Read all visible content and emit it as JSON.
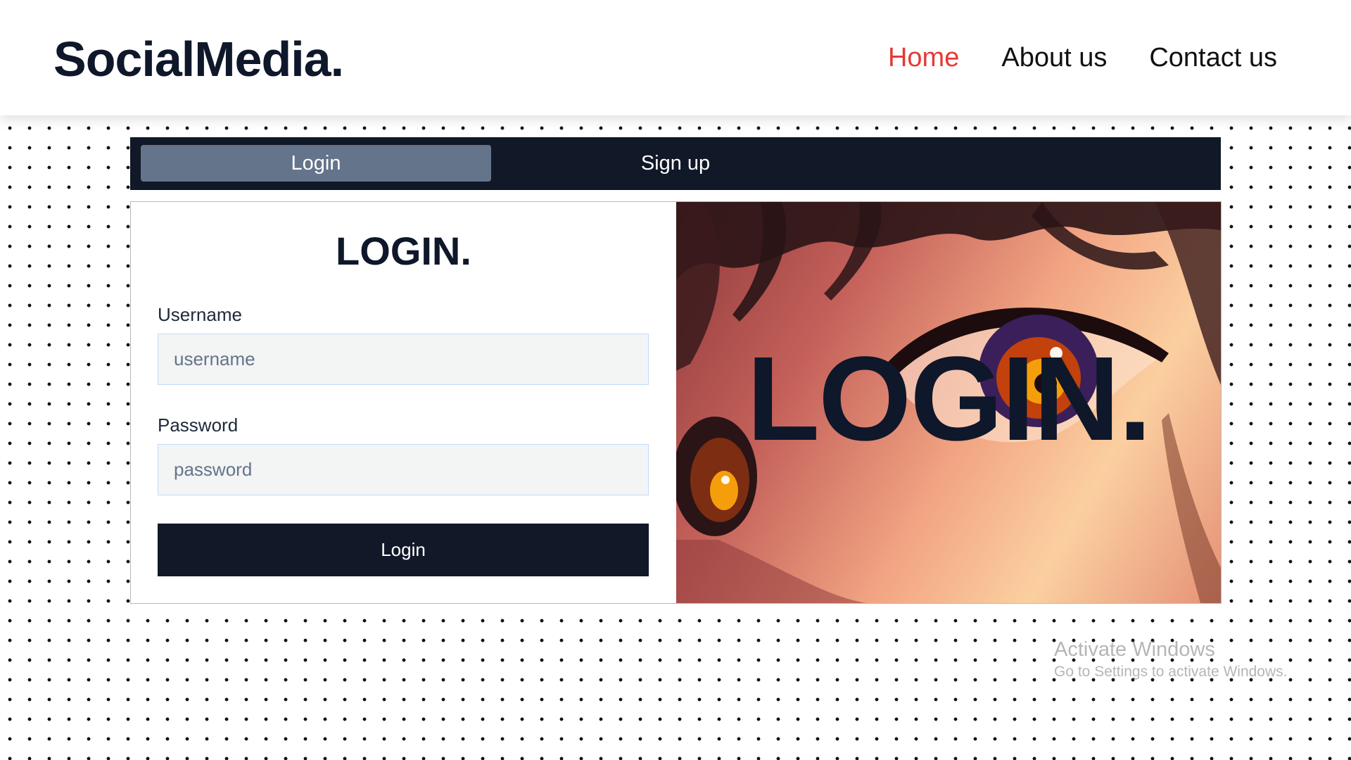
{
  "header": {
    "logo": "SocialMedia.",
    "nav": [
      {
        "label": "Home",
        "active": true
      },
      {
        "label": "About us",
        "active": false
      },
      {
        "label": "Contact us",
        "active": false
      }
    ],
    "nav_active_color": "#e53935"
  },
  "tabs": [
    {
      "label": "Login",
      "active": true
    },
    {
      "label": "Sign up",
      "active": false
    }
  ],
  "form": {
    "title": "LOGIN.",
    "username_label": "Username",
    "username_placeholder": "username",
    "username_value": "",
    "password_label": "Password",
    "password_placeholder": "password",
    "password_value": "",
    "submit_label": "Login"
  },
  "hero": {
    "text": "LOGIN.",
    "image": "anime-eye-closeup-illustration"
  },
  "watermark": {
    "title": "Activate Windows",
    "subtitle": "Go to Settings to activate Windows."
  },
  "colors": {
    "dark": "#111827",
    "active_tab": "#64748b",
    "input_bg": "#f3f4f4"
  }
}
